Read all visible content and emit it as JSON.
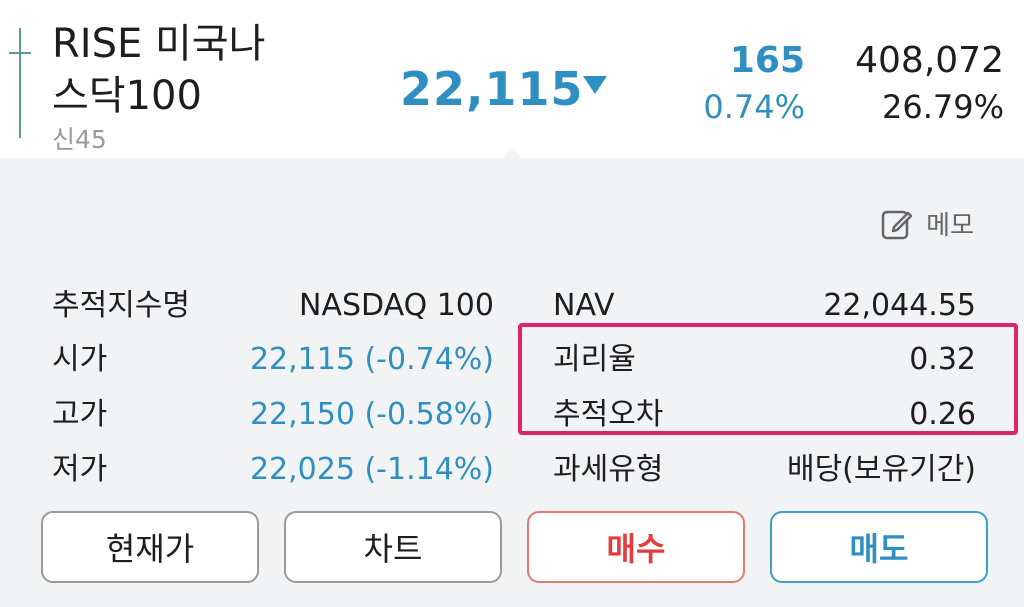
{
  "header": {
    "name_line1": "RISE 미국나",
    "name_line2": "스닥100",
    "code": "신45",
    "price": "22,115",
    "change_value": "165",
    "change_pct": "0.74%",
    "volume": "408,072",
    "volume_pct": "26.79%"
  },
  "memo": {
    "label": "메모"
  },
  "left_table": [
    {
      "label": "추적지수명",
      "value": "NASDAQ 100"
    },
    {
      "label": "시가",
      "value": "22,115 (-0.74%)"
    },
    {
      "label": "고가",
      "value": "22,150 (-0.58%)"
    },
    {
      "label": "저가",
      "value": "22,025 (-1.14%)"
    }
  ],
  "right_table": [
    {
      "label": "NAV",
      "value": "22,044.55"
    },
    {
      "label": "괴리율",
      "value": "0.32"
    },
    {
      "label": "추적오차",
      "value": "0.26"
    },
    {
      "label": "과세유형",
      "value": "배당(보유기간)"
    }
  ],
  "buttons": {
    "current_price": "현재가",
    "chart": "차트",
    "buy": "매수",
    "sell": "매도"
  },
  "colors": {
    "accent_blue": "#2f8fc2",
    "buy_red": "#e23c3c",
    "highlight_pink": "#e0246c",
    "panel_bg": "#f2f3f5"
  }
}
